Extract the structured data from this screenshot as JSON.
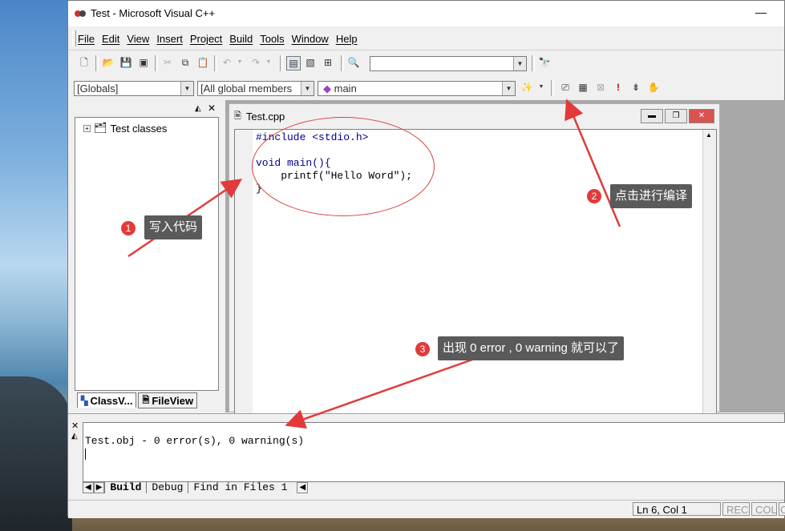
{
  "window": {
    "title": "Test - Microsoft Visual C++",
    "min_glyph": "—"
  },
  "menu": [
    "File",
    "Edit",
    "View",
    "Insert",
    "Project",
    "Build",
    "Tools",
    "Window",
    "Help"
  ],
  "toolbar": {
    "find_combo_value": "",
    "globals_combo": "[Globals]",
    "members_combo": "[All global members",
    "function_combo": "main"
  },
  "classview": {
    "root_label": "Test classes",
    "tab_classview": "ClassV...",
    "tab_fileview": "FileView"
  },
  "editor": {
    "file_title": "Test.cpp",
    "lines": [
      "#include <stdio.h>",
      "",
      "void main(){",
      "    printf(\"Hello Word\");",
      "}"
    ]
  },
  "output": {
    "line1": "Test.obj - 0 error(s), 0 warning(s)",
    "tabs": [
      "Build",
      "Debug",
      "Find in Files 1"
    ]
  },
  "status": {
    "position": "Ln 6, Col 1",
    "rec": "REC",
    "col": "COL",
    "ovr": "O"
  },
  "annotations": [
    {
      "num": "1",
      "text": "写入代码"
    },
    {
      "num": "2",
      "text": "点击进行编译"
    },
    {
      "num": "3",
      "text": "出现 0 error , 0 warning 就可以了"
    }
  ],
  "colors": {
    "annotation_red": "#e23a3a",
    "tooltip_bg": "#5a5a5a",
    "keyword": "#00008b"
  }
}
